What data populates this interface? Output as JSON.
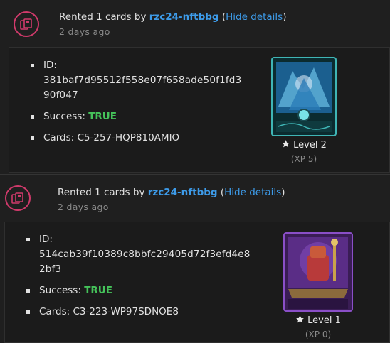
{
  "entries": [
    {
      "title_prefix": "Rented 1 cards by ",
      "user": "rzc24-nftbbg",
      "open_paren": " (",
      "toggle": "Hide details",
      "close_paren": ")",
      "time": "2 days ago",
      "id_label": "ID:",
      "id_value": "381baf7d95512f558e07f658ade50f1fd390f047",
      "success_label": "Success: ",
      "success_value": "TRUE",
      "cards_label": "Cards: ",
      "cards_value": "C5-257-HQP810AMIO",
      "level": "Level 2",
      "xp": "(XP 5)"
    },
    {
      "title_prefix": "Rented 1 cards by ",
      "user": "rzc24-nftbbg",
      "open_paren": " (",
      "toggle": "Hide details",
      "close_paren": ")",
      "time": "2 days ago",
      "id_label": "ID:",
      "id_value": "514cab39f10389c8bbfc29405d72f3efd4e82bf3",
      "success_label": "Success: ",
      "success_value": "TRUE",
      "cards_label": "Cards: ",
      "cards_value": "C3-223-WP97SDNOE8",
      "level": "Level 1",
      "xp": "(XP 0)"
    }
  ],
  "colors": {
    "accent": "#3d9be9",
    "success": "#45c35a",
    "icon_ring": "#d03a6b"
  },
  "icons": {
    "activity": "cards-icon",
    "level": "star-icon"
  }
}
